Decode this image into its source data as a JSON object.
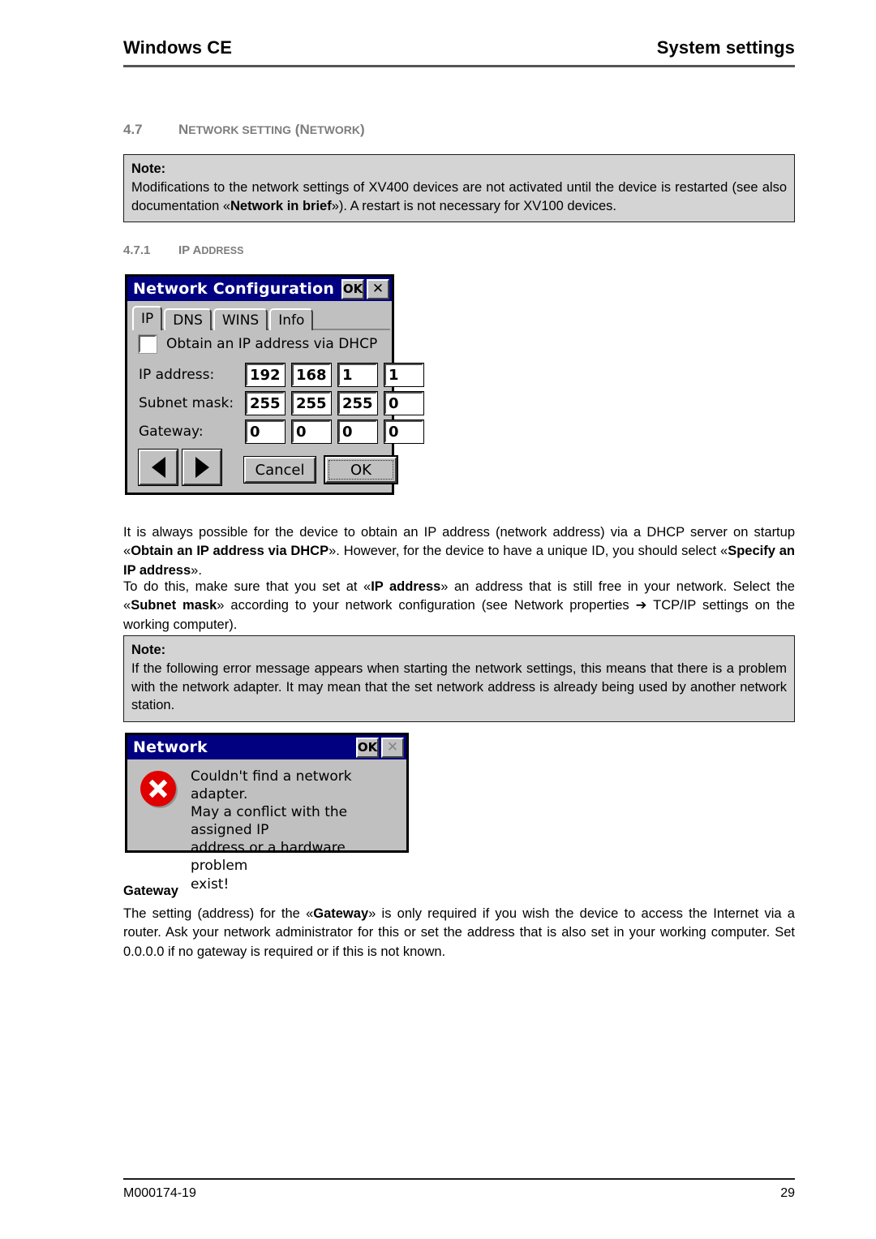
{
  "header": {
    "left": "Windows CE",
    "right": "System settings"
  },
  "section": {
    "number": "4.7",
    "title_cap1": "N",
    "title_rest1": "ETWORK SETTING",
    "title_paren_open": " (N",
    "title_rest2": "ETWORK",
    "title_paren_close": ")"
  },
  "subsection": {
    "number": "4.7.1",
    "title_cap": "IP A",
    "title_rest": "DDRESS"
  },
  "note_1": {
    "title": "Note:",
    "text_part1": "Modifications to the network settings of XV400 devices are not activated until the device is restarted (see also documentation «",
    "bold": "Network in brief",
    "text_part2": "»). A restart is not necessary for XV100 devices."
  },
  "note_2": {
    "title": "Note:",
    "text": "If the following error message appears when starting the network settings, this means that there is a problem with the network adapter. It may mean that the set network address is already being used by another network station."
  },
  "paragraph_dhcp": {
    "part1": "It is always possible for the device to obtain an IP address (network address) via a DHCP server on startup «",
    "bold1": "Obtain an IP address via DHCP",
    "part2": "». However, for the device to have a unique ID, you should select «",
    "bold2": "Specify an IP address",
    "part3": "»."
  },
  "paragraph_ip": {
    "part1": "To do this, make sure that you set at «",
    "bold1": "IP address",
    "part2": "» an address that is still free in your network. Select the «",
    "bold2": "Subnet mask",
    "part3": "» according to your network configuration (see Network properties ",
    "arrow": "➔",
    "part4": " TCP/IP settings on the working computer)."
  },
  "gateway_section": {
    "label": "Gateway",
    "part1": "The setting (address) for the «",
    "bold1": "Gateway",
    "part2": "» is only required if you wish the device to access the Internet via a router. Ask your network administrator for this or set the address that is also set in your working computer. Set 0.0.0.0 if no gateway is required or if this is not known."
  },
  "network_config_dialog": {
    "title": "Network Configuration",
    "titlebar_ok": "OK",
    "titlebar_close": "✕",
    "tabs": [
      {
        "label": "IP",
        "active": true
      },
      {
        "label": "DNS",
        "active": false
      },
      {
        "label": "WINS",
        "active": false
      },
      {
        "label": "Info",
        "active": false
      }
    ],
    "checkbox": {
      "label": "Obtain an IP address via DHCP",
      "checked": false
    },
    "fields": [
      {
        "label": "IP address:",
        "octets": [
          "192",
          "168",
          "1",
          "1"
        ]
      },
      {
        "label": "Subnet mask:",
        "octets": [
          "255",
          "255",
          "255",
          "0"
        ]
      },
      {
        "label": "Gateway:",
        "octets": [
          "0",
          "0",
          "0",
          "0"
        ]
      }
    ],
    "nav_prev": "◀",
    "nav_next": "▶",
    "cancel_label": "Cancel",
    "ok_label": "OK"
  },
  "error_dialog": {
    "title": "Network",
    "titlebar_ok": "OK",
    "titlebar_close": "✕",
    "message": "Couldn't find a network adapter.\nMay a conflict with the assigned IP\naddress or a hardware problem\nexist!"
  },
  "footer": {
    "doc_id": "M000174-19",
    "page_number": "29"
  },
  "colors": {
    "titlebar": "#000080",
    "dialog_face": "#c0c0c0",
    "note_bg": "#d4d4d4",
    "heading_gray": "#7d7d7d",
    "error_red": "#e00000"
  }
}
